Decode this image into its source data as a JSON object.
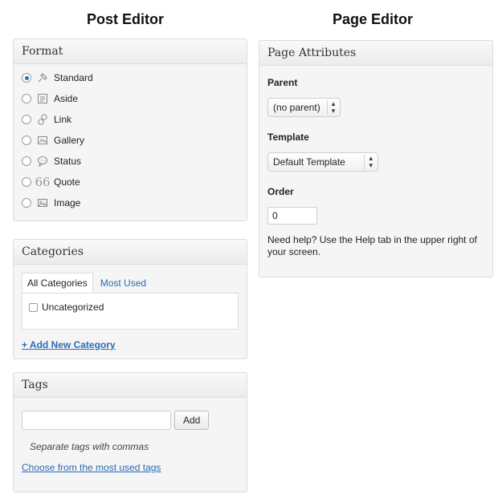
{
  "headers": {
    "post_editor": "Post Editor",
    "page_editor": "Page Editor"
  },
  "format_box": {
    "title": "Format",
    "options": [
      {
        "label": "Standard",
        "icon": "pin-icon",
        "checked": true
      },
      {
        "label": "Aside",
        "icon": "aside-icon",
        "checked": false
      },
      {
        "label": "Link",
        "icon": "link-icon",
        "checked": false
      },
      {
        "label": "Gallery",
        "icon": "gallery-icon",
        "checked": false
      },
      {
        "label": "Status",
        "icon": "status-bubble-icon",
        "checked": false
      },
      {
        "label": "Quote",
        "icon": "quote-icon",
        "checked": false
      },
      {
        "label": "Image",
        "icon": "image-icon",
        "checked": false
      }
    ]
  },
  "categories_box": {
    "title": "Categories",
    "tabs": [
      "All Categories",
      "Most Used"
    ],
    "items": [
      {
        "label": "Uncategorized",
        "checked": false
      }
    ],
    "add_new": "+ Add New Category"
  },
  "tags_box": {
    "title": "Tags",
    "input_value": "",
    "add_button": "Add",
    "hint": "Separate tags with commas",
    "choose_link": "Choose from the most used tags"
  },
  "page_attributes": {
    "title": "Page Attributes",
    "parent_label": "Parent",
    "parent_value": "(no parent)",
    "template_label": "Template",
    "template_value": "Default Template",
    "order_label": "Order",
    "order_value": "0",
    "help_text": "Need help? Use the Help tab in the upper right of your screen."
  },
  "colors": {
    "link": "#2a6bb5",
    "panel_bg": "#f5f5f5",
    "border": "#dcdcdc"
  }
}
